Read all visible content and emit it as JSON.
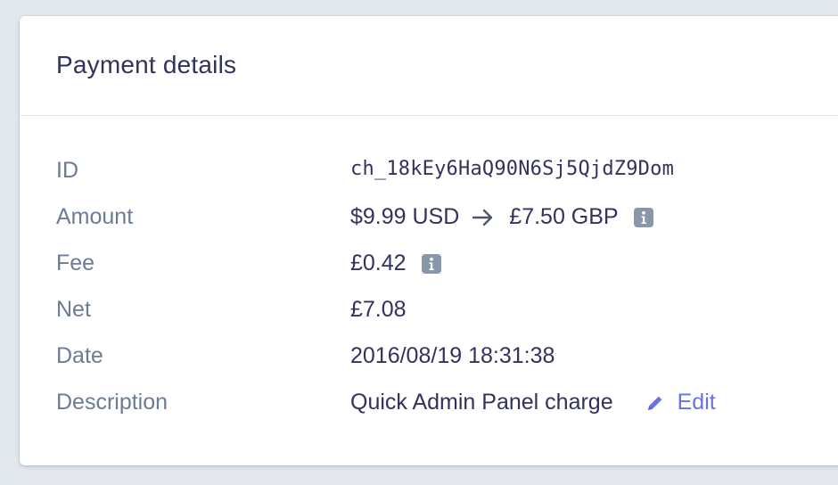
{
  "card": {
    "title": "Payment details"
  },
  "details": {
    "id": {
      "label": "ID",
      "value": "ch_18kEy6HaQ90N6Sj5QjdZ9Dom"
    },
    "amount": {
      "label": "Amount",
      "original": "$9.99 USD",
      "converted": "£7.50 GBP",
      "info_icon": "info-icon",
      "arrow_icon": "arrow-right-icon"
    },
    "fee": {
      "label": "Fee",
      "value": "£0.42",
      "info_icon": "info-icon"
    },
    "net": {
      "label": "Net",
      "value": "£7.08"
    },
    "date": {
      "label": "Date",
      "value": "2016/08/19 18:31:38"
    },
    "description": {
      "label": "Description",
      "value": "Quick Admin Panel charge",
      "edit_label": "Edit",
      "edit_icon": "pencil-icon"
    }
  },
  "colors": {
    "background": "#e3e7ee",
    "title": "#32325d",
    "label": "#6b7c93",
    "value": "#32325d",
    "link": "#6772e5",
    "info_icon": "#8898aa"
  }
}
